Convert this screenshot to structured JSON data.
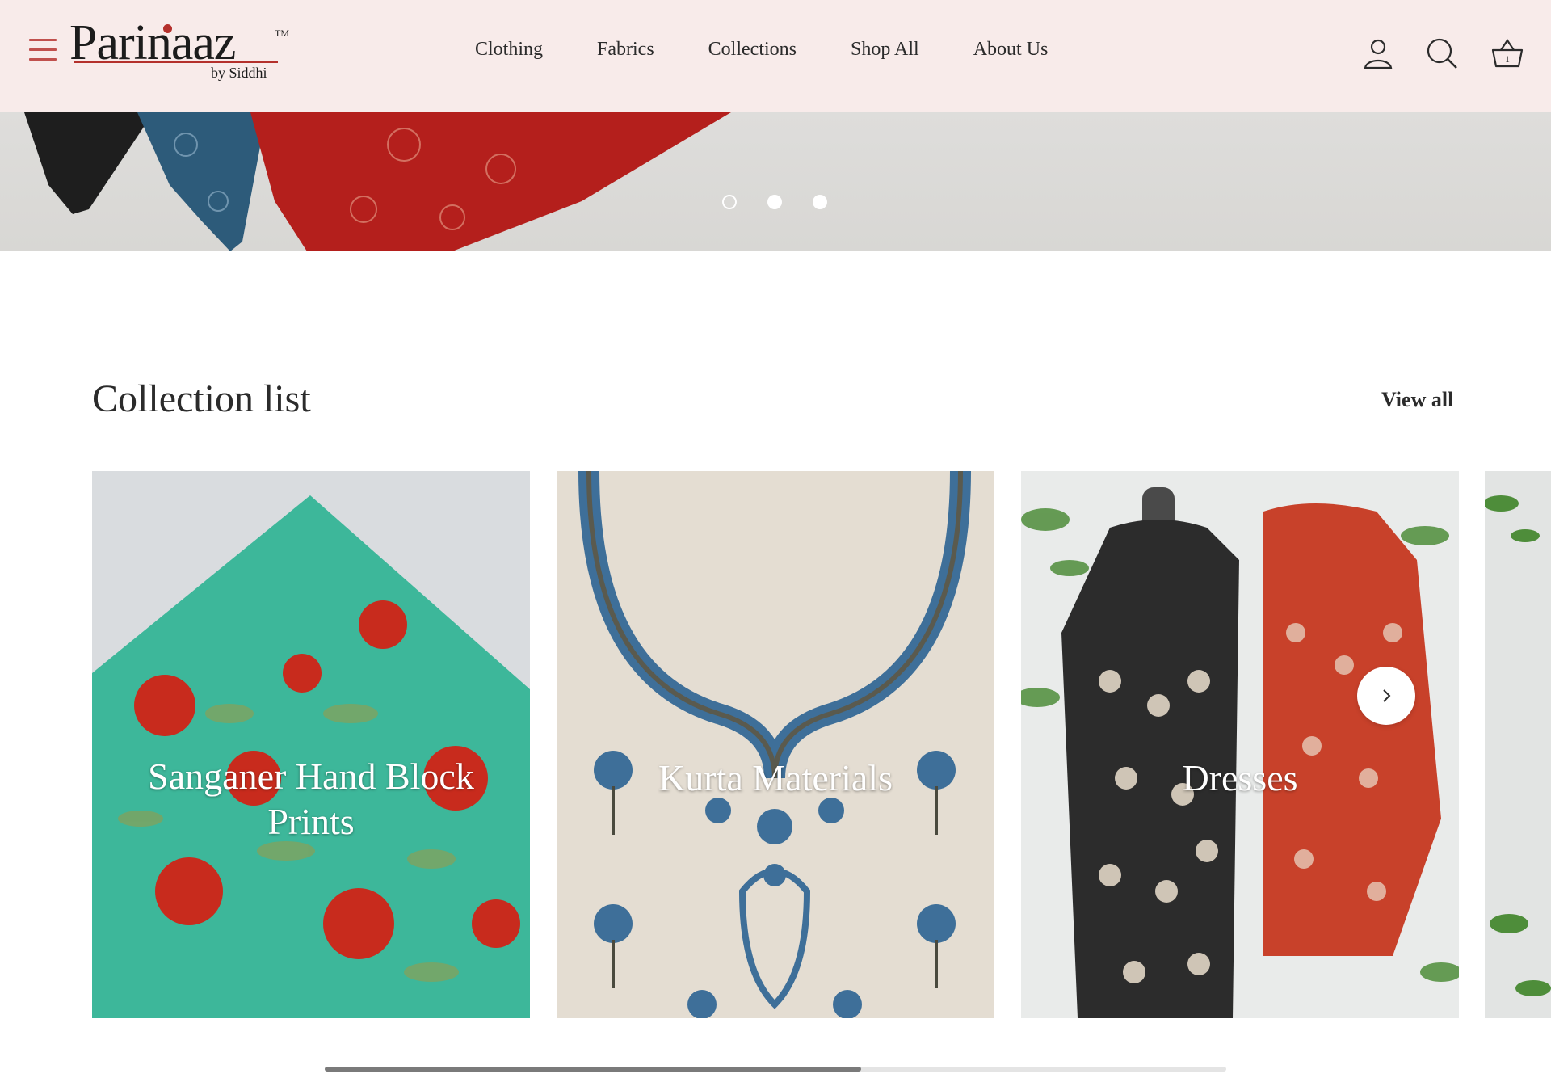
{
  "header": {
    "logo": {
      "name": "Parinaaz",
      "tm": "TM",
      "tagline": "by Siddhi"
    },
    "nav": [
      "Clothing",
      "Fabrics",
      "Collections",
      "Shop All",
      "About Us"
    ],
    "icons": [
      "menu-icon",
      "account-icon",
      "search-icon",
      "basket-icon"
    ],
    "cart_count": "1"
  },
  "hero": {
    "slide_count": 3,
    "active_slide": 1
  },
  "collection": {
    "title": "Collection list",
    "view_all": "View all",
    "cards": [
      {
        "label": "Sanganer Hand Block Prints"
      },
      {
        "label": "Kurta Materials"
      },
      {
        "label": "Dresses"
      }
    ]
  },
  "colors": {
    "header_bg": "#f8ebea",
    "accent": "#b4302c",
    "text": "#2b2b2b"
  }
}
